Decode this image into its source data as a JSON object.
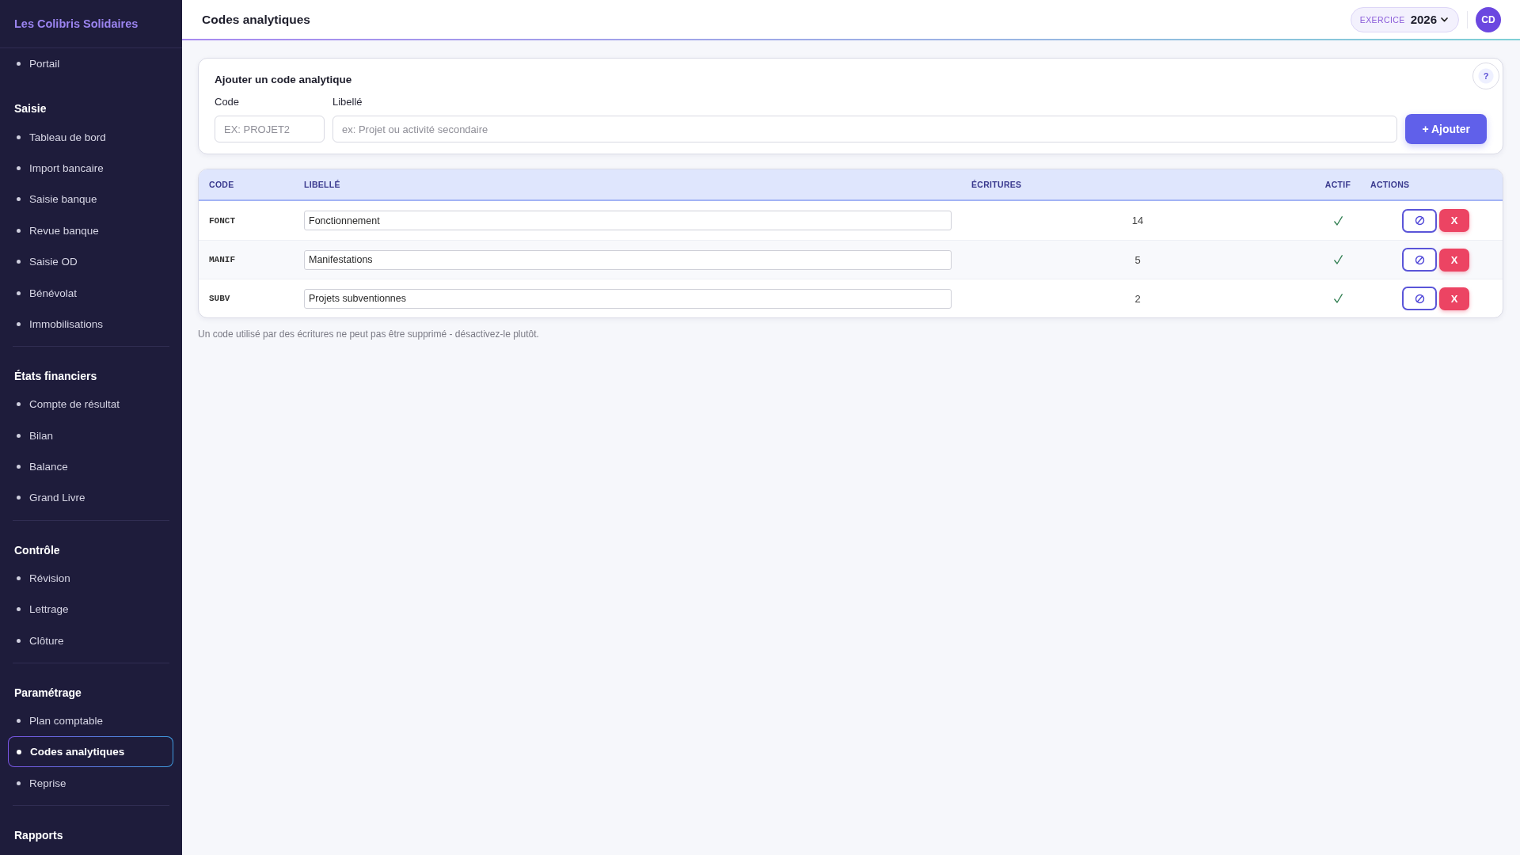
{
  "sidebar": {
    "brand": "Les Colibris Solidaires",
    "sections": [
      {
        "items": [
          {
            "label": "Portail",
            "selected": false
          }
        ]
      },
      {
        "heading": "Saisie",
        "items": [
          {
            "label": "Tableau de bord",
            "selected": false
          },
          {
            "label": "Import bancaire",
            "selected": false
          },
          {
            "label": "Saisie banque",
            "selected": false
          },
          {
            "label": "Revue banque",
            "selected": false
          },
          {
            "label": "Saisie OD",
            "selected": false
          },
          {
            "label": "Bénévolat",
            "selected": false
          },
          {
            "label": "Immobilisations",
            "selected": false
          }
        ]
      },
      {
        "heading": "États financiers",
        "items": [
          {
            "label": "Compte de résultat",
            "selected": false
          },
          {
            "label": "Bilan",
            "selected": false
          },
          {
            "label": "Balance",
            "selected": false
          },
          {
            "label": "Grand Livre",
            "selected": false
          }
        ]
      },
      {
        "heading": "Contrôle",
        "items": [
          {
            "label": "Révision",
            "selected": false
          },
          {
            "label": "Lettrage",
            "selected": false
          },
          {
            "label": "Clôture",
            "selected": false
          }
        ]
      },
      {
        "heading": "Paramétrage",
        "items": [
          {
            "label": "Plan comptable",
            "selected": false
          },
          {
            "label": "Codes analytiques",
            "selected": true
          },
          {
            "label": "Reprise",
            "selected": false
          }
        ]
      },
      {
        "heading": "Rapports"
      }
    ]
  },
  "header": {
    "title": "Codes analytiques",
    "fiscal_year": {
      "label": "EXERCICE",
      "value": "2026"
    },
    "avatar": {
      "initials": "CD"
    }
  },
  "add_form": {
    "title": "Ajouter un code analytique",
    "help": "?",
    "fields": [
      {
        "label": "Code",
        "placeholder": "EX: PROJET2"
      },
      {
        "label": "Libellé",
        "placeholder": "ex: Projet ou activité secondaire"
      }
    ],
    "submit": "+ Ajouter"
  },
  "table": {
    "columns": [
      "CODE",
      "LIBELLÉ",
      "ÉCRITURES",
      "ACTIF",
      "ACTIONS"
    ],
    "rows": [
      {
        "code": "FONCT",
        "label": "Fonctionnement",
        "entries": "14",
        "active": true,
        "delete_label": "X"
      },
      {
        "code": "MANIF",
        "label": "Manifestations",
        "entries": "5",
        "active": true,
        "delete_label": "X"
      },
      {
        "code": "SUBV",
        "label": "Projets subventionnes",
        "entries": "2",
        "active": true,
        "delete_label": "X"
      }
    ]
  },
  "note": "Un code utilisé par des écritures ne peut pas être supprimé - désactivez-le plutôt."
}
